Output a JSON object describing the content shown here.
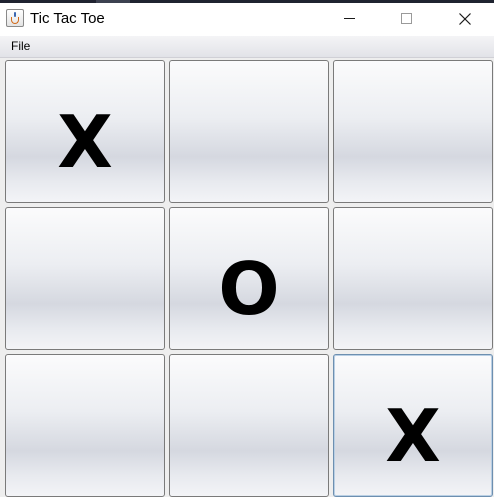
{
  "window": {
    "title": "Tic Tac Toe",
    "app_icon": "java-cup-icon"
  },
  "controls": {
    "minimize_icon": "minimize-icon",
    "maximize_icon": "maximize-icon",
    "close_icon": "close-icon"
  },
  "menubar": {
    "file_label": "File"
  },
  "board": {
    "rows": 3,
    "cols": 3,
    "cells": [
      "X",
      "",
      "",
      "",
      "O",
      "",
      "",
      "",
      "X"
    ],
    "focused_cell": 8
  }
}
